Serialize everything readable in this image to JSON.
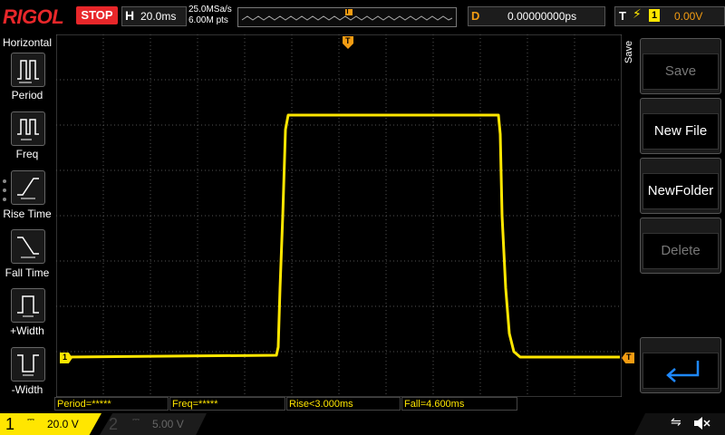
{
  "brand": "RIGOL",
  "run_state": "STOP",
  "timebase": {
    "letter": "H",
    "value": "20.0ms"
  },
  "acquisition": {
    "sample_rate": "25.0MSa/s",
    "mem_depth": "6.00M pts"
  },
  "trigger_pos_marker": "T",
  "delay": {
    "letter": "D",
    "value": "0.00000000ps"
  },
  "trigger": {
    "letter": "T",
    "source": "1",
    "level": "0.00V"
  },
  "left_menu": {
    "title": "Horizontal",
    "items": [
      {
        "label": "Period",
        "icon": "period-icon"
      },
      {
        "label": "Freq",
        "icon": "freq-icon"
      },
      {
        "label": "Rise Time",
        "icon": "rise-time-icon"
      },
      {
        "label": "Fall Time",
        "icon": "fall-time-icon"
      },
      {
        "label": "+Width",
        "icon": "pos-width-icon"
      },
      {
        "label": "-Width",
        "icon": "neg-width-icon"
      }
    ]
  },
  "right_menu": {
    "title": "Save",
    "items": [
      {
        "label": "Save",
        "enabled": false
      },
      {
        "label": "New File",
        "enabled": true
      },
      {
        "label": "NewFolder",
        "enabled": true
      },
      {
        "label": "Delete",
        "enabled": false
      }
    ],
    "back_icon": "return-arrow-icon"
  },
  "measurements": [
    {
      "text": "Period=*****"
    },
    {
      "text": "Freq=*****"
    },
    {
      "text": "Rise<3.000ms"
    },
    {
      "text": "Fall=4.600ms"
    }
  ],
  "channels": [
    {
      "number": "1",
      "coupling": "DC",
      "scale": "20.0 V",
      "active": true
    },
    {
      "number": "2",
      "coupling": "DC",
      "scale": "5.00 V",
      "active": false
    }
  ],
  "ch1_marker": "1",
  "trigger_level_marker": "T",
  "status_icons": [
    "usb-icon",
    "speaker-muted-icon"
  ],
  "colors": {
    "ch1": "#ffe600",
    "brand": "#e8272a",
    "accent": "#f39c12",
    "button_blue": "#1e88ff"
  }
}
